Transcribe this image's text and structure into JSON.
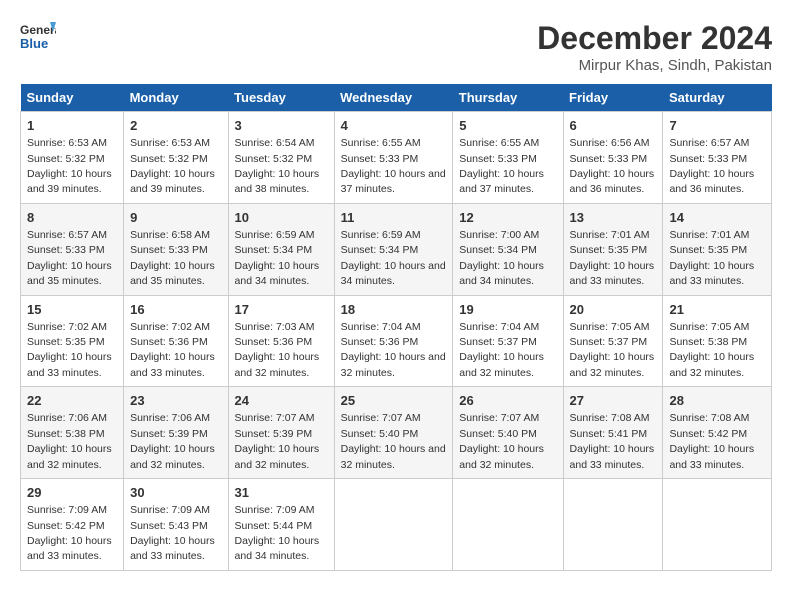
{
  "logo": {
    "line1": "General",
    "line2": "Blue"
  },
  "title": "December 2024",
  "subtitle": "Mirpur Khas, Sindh, Pakistan",
  "days_header": [
    "Sunday",
    "Monday",
    "Tuesday",
    "Wednesday",
    "Thursday",
    "Friday",
    "Saturday"
  ],
  "weeks": [
    [
      {
        "day": "1",
        "detail": "Sunrise: 6:53 AM\nSunset: 5:32 PM\nDaylight: 10 hours and 39 minutes."
      },
      {
        "day": "2",
        "detail": "Sunrise: 6:53 AM\nSunset: 5:32 PM\nDaylight: 10 hours and 39 minutes."
      },
      {
        "day": "3",
        "detail": "Sunrise: 6:54 AM\nSunset: 5:32 PM\nDaylight: 10 hours and 38 minutes."
      },
      {
        "day": "4",
        "detail": "Sunrise: 6:55 AM\nSunset: 5:33 PM\nDaylight: 10 hours and 37 minutes."
      },
      {
        "day": "5",
        "detail": "Sunrise: 6:55 AM\nSunset: 5:33 PM\nDaylight: 10 hours and 37 minutes."
      },
      {
        "day": "6",
        "detail": "Sunrise: 6:56 AM\nSunset: 5:33 PM\nDaylight: 10 hours and 36 minutes."
      },
      {
        "day": "7",
        "detail": "Sunrise: 6:57 AM\nSunset: 5:33 PM\nDaylight: 10 hours and 36 minutes."
      }
    ],
    [
      {
        "day": "8",
        "detail": "Sunrise: 6:57 AM\nSunset: 5:33 PM\nDaylight: 10 hours and 35 minutes."
      },
      {
        "day": "9",
        "detail": "Sunrise: 6:58 AM\nSunset: 5:33 PM\nDaylight: 10 hours and 35 minutes."
      },
      {
        "day": "10",
        "detail": "Sunrise: 6:59 AM\nSunset: 5:34 PM\nDaylight: 10 hours and 34 minutes."
      },
      {
        "day": "11",
        "detail": "Sunrise: 6:59 AM\nSunset: 5:34 PM\nDaylight: 10 hours and 34 minutes."
      },
      {
        "day": "12",
        "detail": "Sunrise: 7:00 AM\nSunset: 5:34 PM\nDaylight: 10 hours and 34 minutes."
      },
      {
        "day": "13",
        "detail": "Sunrise: 7:01 AM\nSunset: 5:35 PM\nDaylight: 10 hours and 33 minutes."
      },
      {
        "day": "14",
        "detail": "Sunrise: 7:01 AM\nSunset: 5:35 PM\nDaylight: 10 hours and 33 minutes."
      }
    ],
    [
      {
        "day": "15",
        "detail": "Sunrise: 7:02 AM\nSunset: 5:35 PM\nDaylight: 10 hours and 33 minutes."
      },
      {
        "day": "16",
        "detail": "Sunrise: 7:02 AM\nSunset: 5:36 PM\nDaylight: 10 hours and 33 minutes."
      },
      {
        "day": "17",
        "detail": "Sunrise: 7:03 AM\nSunset: 5:36 PM\nDaylight: 10 hours and 32 minutes."
      },
      {
        "day": "18",
        "detail": "Sunrise: 7:04 AM\nSunset: 5:36 PM\nDaylight: 10 hours and 32 minutes."
      },
      {
        "day": "19",
        "detail": "Sunrise: 7:04 AM\nSunset: 5:37 PM\nDaylight: 10 hours and 32 minutes."
      },
      {
        "day": "20",
        "detail": "Sunrise: 7:05 AM\nSunset: 5:37 PM\nDaylight: 10 hours and 32 minutes."
      },
      {
        "day": "21",
        "detail": "Sunrise: 7:05 AM\nSunset: 5:38 PM\nDaylight: 10 hours and 32 minutes."
      }
    ],
    [
      {
        "day": "22",
        "detail": "Sunrise: 7:06 AM\nSunset: 5:38 PM\nDaylight: 10 hours and 32 minutes."
      },
      {
        "day": "23",
        "detail": "Sunrise: 7:06 AM\nSunset: 5:39 PM\nDaylight: 10 hours and 32 minutes."
      },
      {
        "day": "24",
        "detail": "Sunrise: 7:07 AM\nSunset: 5:39 PM\nDaylight: 10 hours and 32 minutes."
      },
      {
        "day": "25",
        "detail": "Sunrise: 7:07 AM\nSunset: 5:40 PM\nDaylight: 10 hours and 32 minutes."
      },
      {
        "day": "26",
        "detail": "Sunrise: 7:07 AM\nSunset: 5:40 PM\nDaylight: 10 hours and 32 minutes."
      },
      {
        "day": "27",
        "detail": "Sunrise: 7:08 AM\nSunset: 5:41 PM\nDaylight: 10 hours and 33 minutes."
      },
      {
        "day": "28",
        "detail": "Sunrise: 7:08 AM\nSunset: 5:42 PM\nDaylight: 10 hours and 33 minutes."
      }
    ],
    [
      {
        "day": "29",
        "detail": "Sunrise: 7:09 AM\nSunset: 5:42 PM\nDaylight: 10 hours and 33 minutes."
      },
      {
        "day": "30",
        "detail": "Sunrise: 7:09 AM\nSunset: 5:43 PM\nDaylight: 10 hours and 33 minutes."
      },
      {
        "day": "31",
        "detail": "Sunrise: 7:09 AM\nSunset: 5:44 PM\nDaylight: 10 hours and 34 minutes."
      },
      {
        "day": "",
        "detail": ""
      },
      {
        "day": "",
        "detail": ""
      },
      {
        "day": "",
        "detail": ""
      },
      {
        "day": "",
        "detail": ""
      }
    ]
  ]
}
